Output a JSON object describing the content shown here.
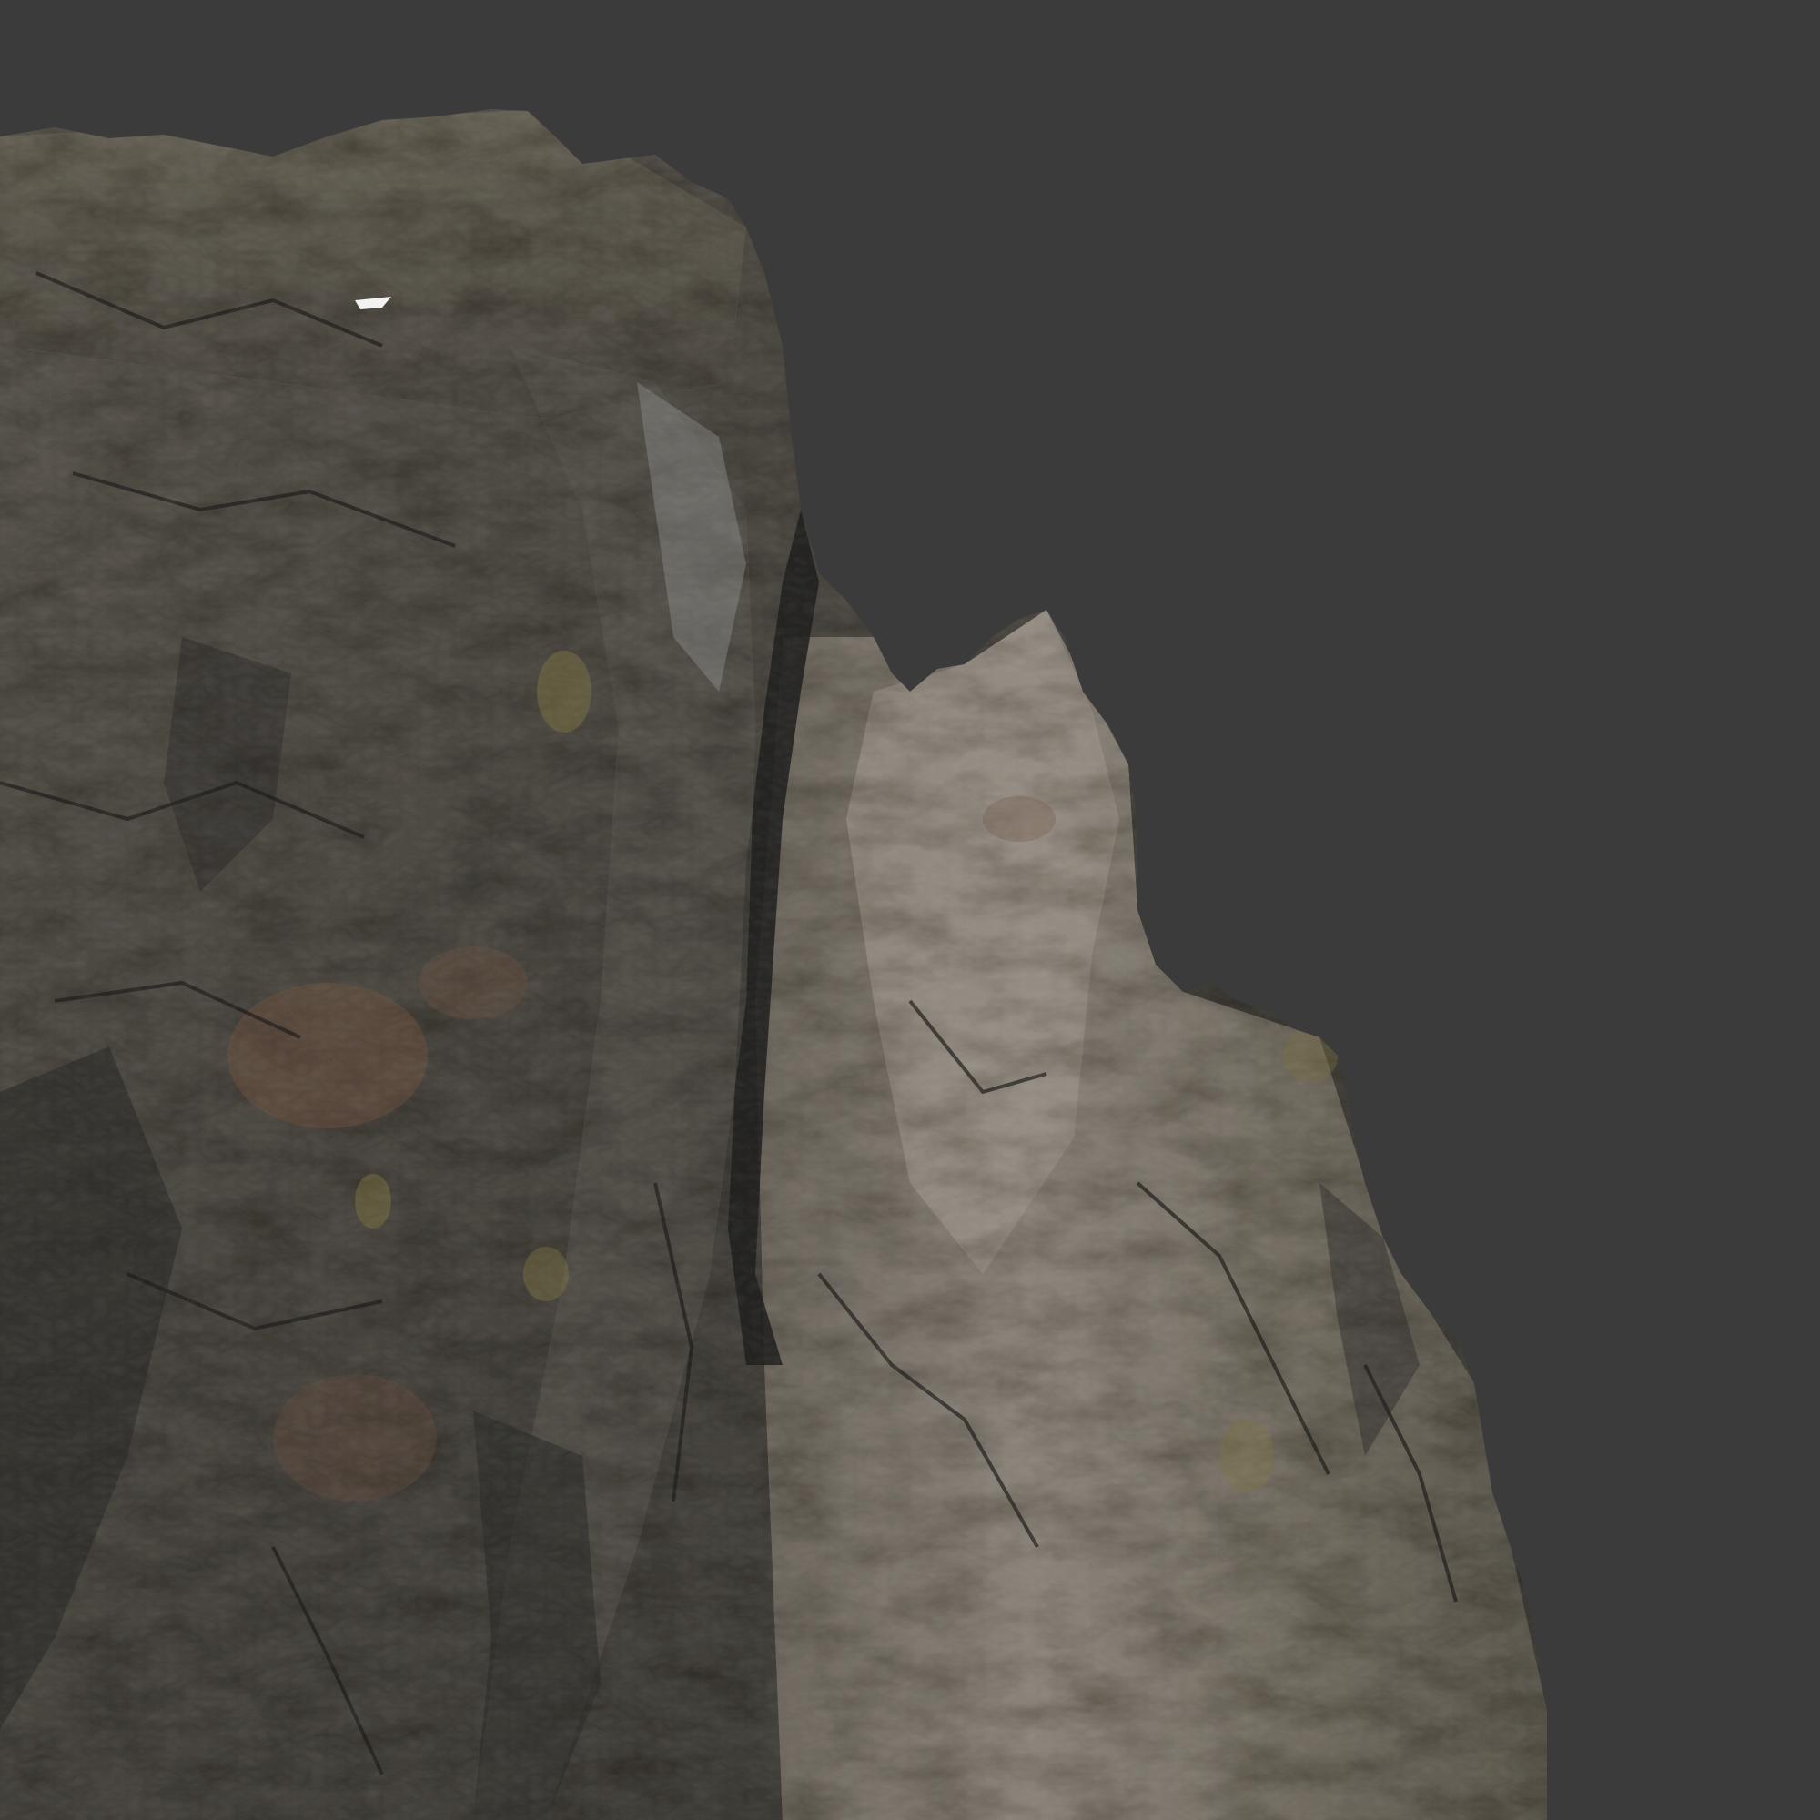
{
  "viewport": {
    "background_color": "#3b3b3b"
  },
  "subject": {
    "name": "rock-cliff-model",
    "colors": {
      "dark_rock": "#3f3d38",
      "mid_rock": "#5e5950",
      "light_rock": "#857d71",
      "pale_face": "#9a9288",
      "shadow": "#1f1f1d",
      "lichen": "#7a7040",
      "rust": "#6e4f3f"
    }
  }
}
